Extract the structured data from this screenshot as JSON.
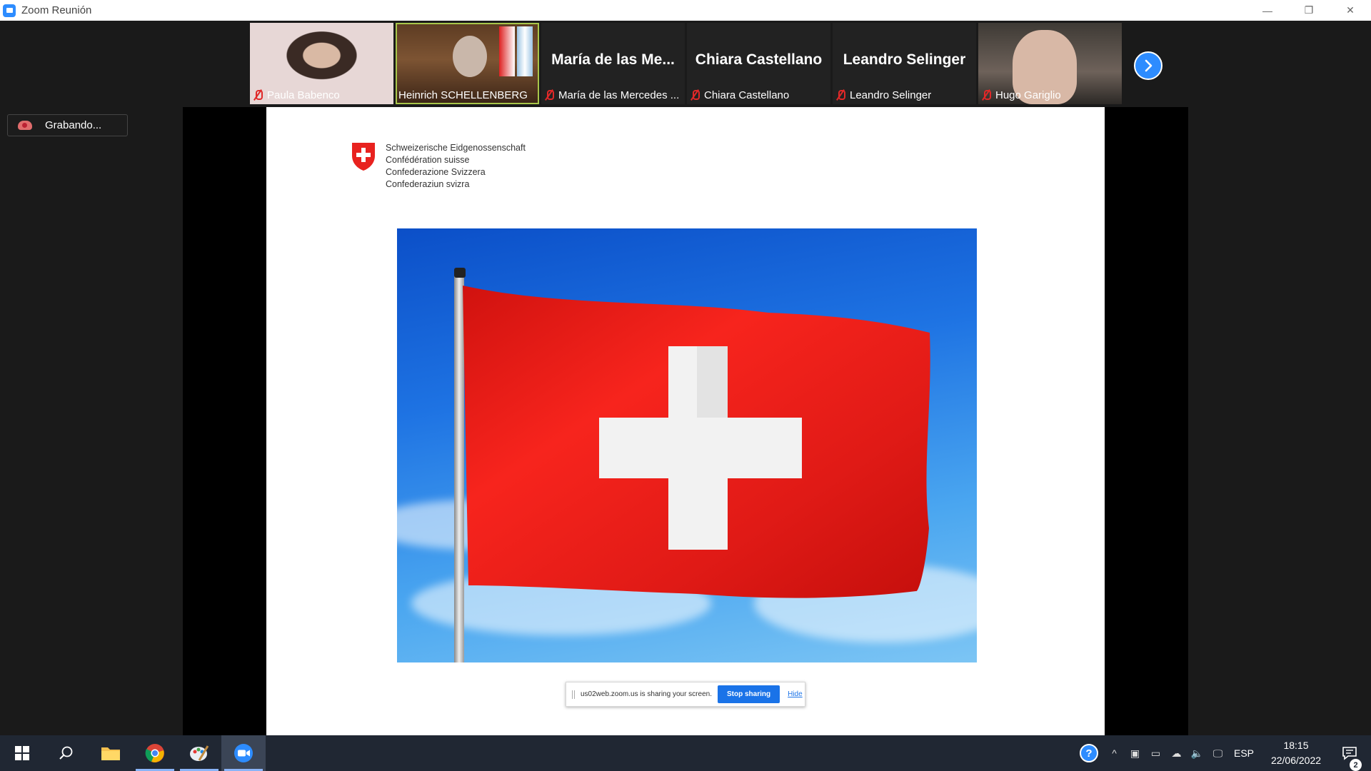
{
  "window": {
    "title": "Zoom Reunión",
    "minimize": "—",
    "restore": "❐",
    "close": "✕"
  },
  "participants": [
    {
      "name": "Paula Babenco",
      "has_video": true,
      "muted": true,
      "active": false
    },
    {
      "name": "Heinrich SCHELLENBERG",
      "has_video": true,
      "muted": false,
      "active": true
    },
    {
      "name": "María de las Mercedes ...",
      "display_name": "María de las Me...",
      "has_video": false,
      "muted": true,
      "active": false
    },
    {
      "name": "Chiara Castellano",
      "display_name": "Chiara Castellano",
      "has_video": false,
      "muted": true,
      "active": false
    },
    {
      "name": "Leandro Selinger",
      "display_name": "Leandro Selinger",
      "has_video": false,
      "muted": true,
      "active": false
    },
    {
      "name": "Hugo Gariglio",
      "has_video": true,
      "muted": true,
      "active": false
    }
  ],
  "recording": {
    "label": "Grabando..."
  },
  "slide": {
    "confederation": [
      "Schweizerische Eidgenossenschaft",
      "Confédération suisse",
      "Confederazione Svizzera",
      "Confederaziun svizra"
    ]
  },
  "share_bar": {
    "message": "us02web.zoom.us is sharing your screen.",
    "stop_label": "Stop sharing",
    "hide_label": "Hide"
  },
  "taskbar": {
    "language": "ESP",
    "time": "18:15",
    "date": "22/06/2022",
    "notification_count": "2"
  },
  "colors": {
    "zoom_blue": "#2d8cff",
    "swiss_red": "#e8221f",
    "active_speaker": "#a8c64a",
    "taskbar": "#202733"
  }
}
